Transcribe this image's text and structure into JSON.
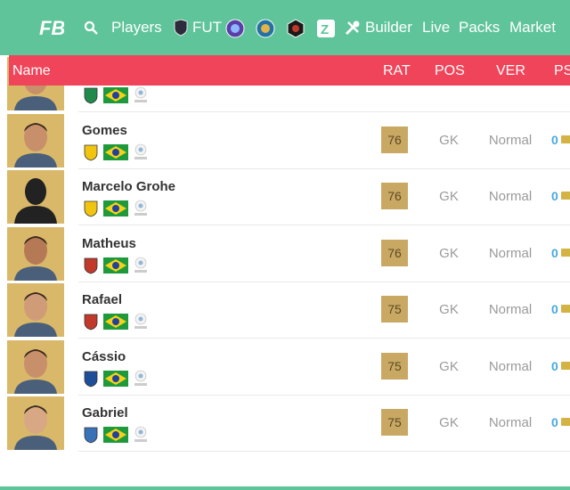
{
  "nav": {
    "items": [
      {
        "id": "players",
        "label": "Players",
        "icon": "search-icon"
      },
      {
        "id": "fut",
        "label": "FUT",
        "icon": "fut-shield-icon"
      },
      {
        "id": "builder",
        "label": "Builder",
        "icon": "tools-icon"
      },
      {
        "id": "live",
        "label": "Live"
      },
      {
        "id": "packs",
        "label": "Packs"
      },
      {
        "id": "market",
        "label": "Market"
      }
    ]
  },
  "table": {
    "columns": {
      "name": "Name",
      "rat": "RAT",
      "pos": "POS",
      "ver": "VER",
      "ps": "PS"
    }
  },
  "players": [
    {
      "name": "",
      "rating": "",
      "position": "",
      "version": "",
      "price": "",
      "club_color": "#1f8a4c",
      "skin": "#c8906a"
    },
    {
      "name": "Gomes",
      "rating": "76",
      "position": "GK",
      "version": "Normal",
      "price": "0",
      "club_color": "#f1c40f",
      "skin": "#c8906a"
    },
    {
      "name": "Marcelo Grohe",
      "rating": "76",
      "position": "GK",
      "version": "Normal",
      "price": "0",
      "club_color": "#f1c40f",
      "skin": "#222222"
    },
    {
      "name": "Matheus",
      "rating": "76",
      "position": "GK",
      "version": "Normal",
      "price": "0",
      "club_color": "#c0392b",
      "skin": "#b57a55"
    },
    {
      "name": "Rafael",
      "rating": "75",
      "position": "GK",
      "version": "Normal",
      "price": "0",
      "club_color": "#c0392b",
      "skin": "#d09c78"
    },
    {
      "name": "Cássio",
      "rating": "75",
      "position": "GK",
      "version": "Normal",
      "price": "0",
      "club_color": "#1f4e99",
      "skin": "#c8906a"
    },
    {
      "name": "Gabriel",
      "rating": "75",
      "position": "GK",
      "version": "Normal",
      "price": "0",
      "club_color": "#3a72b8",
      "skin": "#d8a884"
    }
  ],
  "colors": {
    "accent": "#5fc49a",
    "header": "#ef4459",
    "card": "#d9b86a",
    "price": "#46a9e0"
  }
}
